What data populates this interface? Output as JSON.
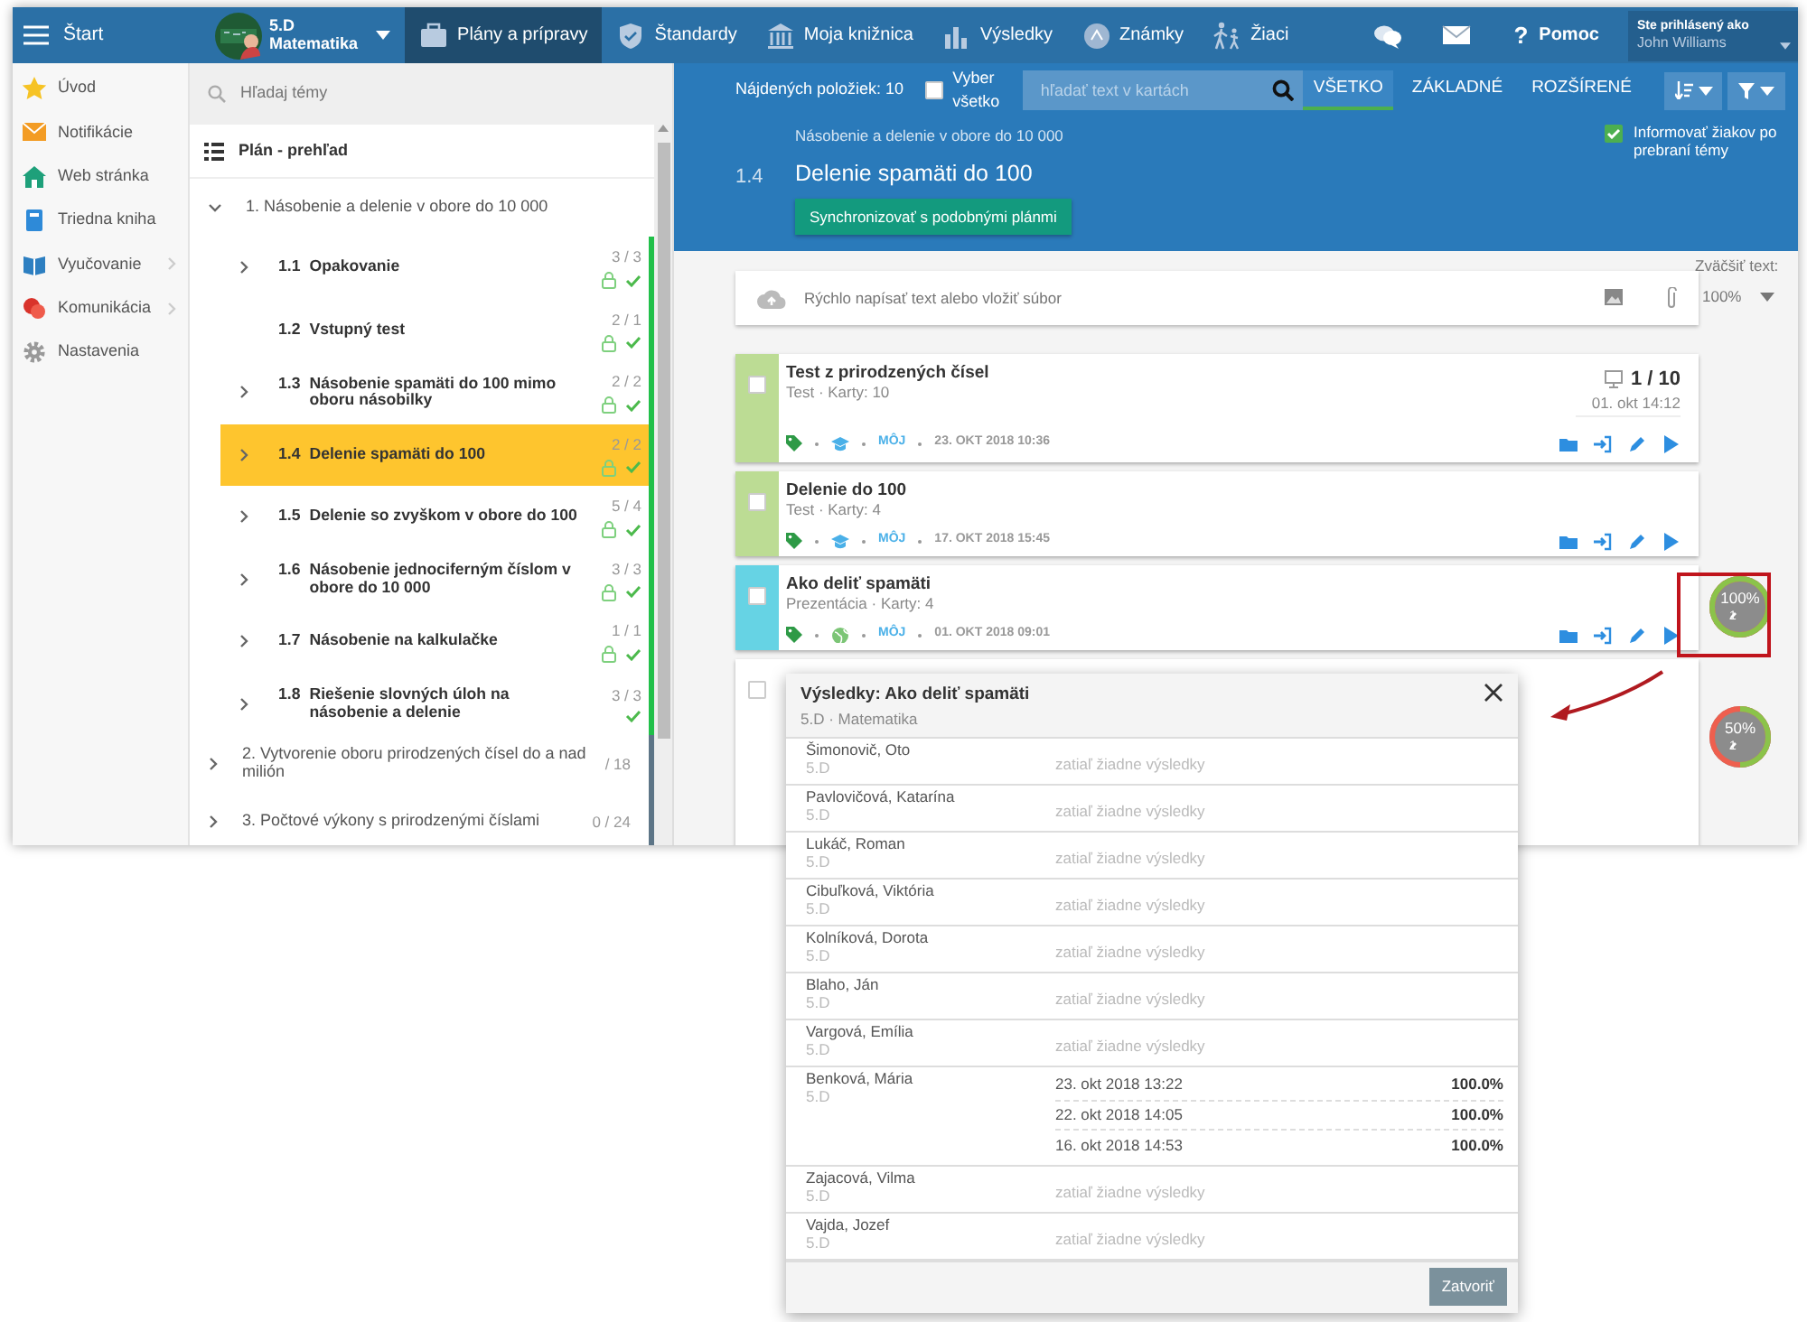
{
  "topbar": {
    "menu_label": "Štart",
    "class_selector": {
      "name": "5.D",
      "subject": "Matematika"
    },
    "nav": [
      {
        "label": "Plány a prípravy",
        "selected": true
      },
      {
        "label": "Štandardy",
        "selected": false
      },
      {
        "label": "Moja knižnica",
        "selected": false
      },
      {
        "label": "Výsledky",
        "selected": false
      },
      {
        "label": "Známky",
        "selected": false
      },
      {
        "label": "Žiaci",
        "selected": false
      }
    ],
    "help": {
      "icon": "?",
      "label": "Pomoc"
    },
    "user": {
      "caption": "Ste prihlásený ako",
      "name": "John Williams"
    }
  },
  "sidebar": {
    "items": [
      {
        "label": "Úvod",
        "has_submenu": false
      },
      {
        "label": "Notifikácie",
        "has_submenu": false
      },
      {
        "label": "Web stránka",
        "has_submenu": false
      },
      {
        "label": "Triedna kniha",
        "has_submenu": false
      },
      {
        "label": "Vyučovanie",
        "has_submenu": true
      },
      {
        "label": "Komunikácia",
        "has_submenu": true
      },
      {
        "label": "Nastavenia",
        "has_submenu": false
      }
    ]
  },
  "plan": {
    "search": {
      "placeholder": "Hľadaj témy"
    },
    "header": "Plán - prehľad",
    "topics": [
      {
        "label": "1. Násobenie a delenie v obore do 10 000",
        "expanded": true,
        "children": [
          {
            "number": "1.1",
            "title": "Opakovanie",
            "count": "3 / 3",
            "has_children": true,
            "locked": true,
            "done": true,
            "selected": false
          },
          {
            "number": "1.2",
            "title": "Vstupný test",
            "count": "2 / 1",
            "has_children": false,
            "locked": true,
            "done": true,
            "selected": false
          },
          {
            "number": "1.3",
            "title": "Násobenie spamäti do 100 mimo oboru násobilky",
            "count": "2 / 2",
            "has_children": true,
            "locked": true,
            "done": true,
            "selected": false
          },
          {
            "number": "1.4",
            "title": "Delenie spamäti do 100",
            "count": "2 / 2",
            "has_children": true,
            "locked": true,
            "done": true,
            "selected": true
          },
          {
            "number": "1.5",
            "title": "Delenie so zvyškom v obore do 100",
            "count": "5 / 4",
            "has_children": true,
            "locked": true,
            "done": true,
            "selected": false
          },
          {
            "number": "1.6",
            "title": "Násobenie jednociferným číslom v obore do 10 000",
            "count": "3 / 3",
            "has_children": true,
            "locked": true,
            "done": true,
            "selected": false
          },
          {
            "number": "1.7",
            "title": "Násobenie na kalkulačke",
            "count": "1 / 1",
            "has_children": true,
            "locked": true,
            "done": true,
            "selected": false
          },
          {
            "number": "1.8",
            "title": "Riešenie slovných úloh na násobenie a delenie",
            "count": "3 / 3",
            "has_children": true,
            "locked": false,
            "done": true,
            "selected": false
          }
        ]
      },
      {
        "label": "2. Vytvorenie oboru prirodzených čísel do a nad milión",
        "count": "/ 18",
        "expanded": false
      },
      {
        "label": "3. Počtové výkony s prirodzenými číslami",
        "count": "0 / 24",
        "expanded": false
      }
    ]
  },
  "toolbar": {
    "found": "Nájdených položiek: 10",
    "select_all": {
      "label": "Vyber všetko",
      "checked": false
    },
    "search": {
      "placeholder": "hľadať text v kartách"
    },
    "filters": [
      {
        "label": "VŠETKO",
        "selected": true
      },
      {
        "label": "ZÁKLADNÉ",
        "selected": false
      },
      {
        "label": "ROZŠÍRENÉ",
        "selected": false
      }
    ]
  },
  "topic": {
    "parent": "Násobenie a delenie v obore do 10 000",
    "number": "1.4",
    "title": "Delenie spamäti do 100",
    "sync_button": "Synchronizovať s podobnými plánmi",
    "notify": {
      "label": "Informovať žiakov po prebraní témy",
      "checked": true
    }
  },
  "quick_input": {
    "placeholder": "Rýchlo napísať text alebo vložiť súbor"
  },
  "text_zoom": {
    "label": "Zväčšiť text:",
    "value": "100%"
  },
  "cards": [
    {
      "title": "Test z prirodzených čísel",
      "meta": "Test · Karty: 10",
      "kind": "test",
      "color": "#bcdc94",
      "owner": "MÔJ",
      "date": "23. OKT 2018 10:36",
      "checked": false,
      "score": {
        "value": "1 / 10",
        "time": "01. okt 14:12"
      }
    },
    {
      "title": "Delenie do 100",
      "meta": "Test · Karty: 4",
      "kind": "test",
      "color": "#bcdc94",
      "owner": "MÔJ",
      "date": "17. OKT 2018 15:45",
      "checked": false
    },
    {
      "title": "Ako deliť spamäti",
      "meta": "Prezentácia · Karty: 4",
      "kind": "presentation",
      "color": "#66d3e4",
      "owner": "MÔJ",
      "date": "01. OKT 2018 09:01",
      "checked": false,
      "result": {
        "label": "100%",
        "count": "1",
        "level": 1
      }
    },
    {
      "kind": "hidden",
      "checked": false,
      "result": {
        "label": "50%",
        "count": "1",
        "level": 0.5
      }
    }
  ],
  "results_dialog": {
    "title": "Výsledky: Ako deliť spamäti",
    "subtitle": "5.D · Matematika",
    "students": [
      {
        "name": "Šimonovič, Oto",
        "class": "5.D",
        "note": "zatiaľ žiadne výsledky"
      },
      {
        "name": "Pavlovičová, Katarína",
        "class": "5.D",
        "note": "zatiaľ žiadne výsledky"
      },
      {
        "name": "Lukáč, Roman",
        "class": "5.D",
        "note": "zatiaľ žiadne výsledky"
      },
      {
        "name": "Cibuľková, Viktória",
        "class": "5.D",
        "note": "zatiaľ žiadne výsledky"
      },
      {
        "name": "Kolníková, Dorota",
        "class": "5.D",
        "note": "zatiaľ žiadne výsledky"
      },
      {
        "name": "Blaho, Ján",
        "class": "5.D",
        "note": "zatiaľ žiadne výsledky"
      },
      {
        "name": "Vargová, Emília",
        "class": "5.D",
        "note": "zatiaľ žiadne výsledky"
      },
      {
        "name": "Benková, Mária",
        "class": "5.D",
        "attempts": [
          {
            "date": "23. okt 2018 13:22",
            "score": "100.0%"
          },
          {
            "date": "22. okt 2018 14:05",
            "score": "100.0%"
          },
          {
            "date": "16. okt 2018 14:53",
            "score": "100.0%"
          }
        ]
      },
      {
        "name": "Zajacová, Vilma",
        "class": "5.D",
        "note": "zatiaľ žiadne výsledky"
      },
      {
        "name": "Vajda, Jozef",
        "class": "5.D",
        "note": "zatiaľ žiadne výsledky"
      }
    ],
    "close_button": "Zatvoriť"
  }
}
